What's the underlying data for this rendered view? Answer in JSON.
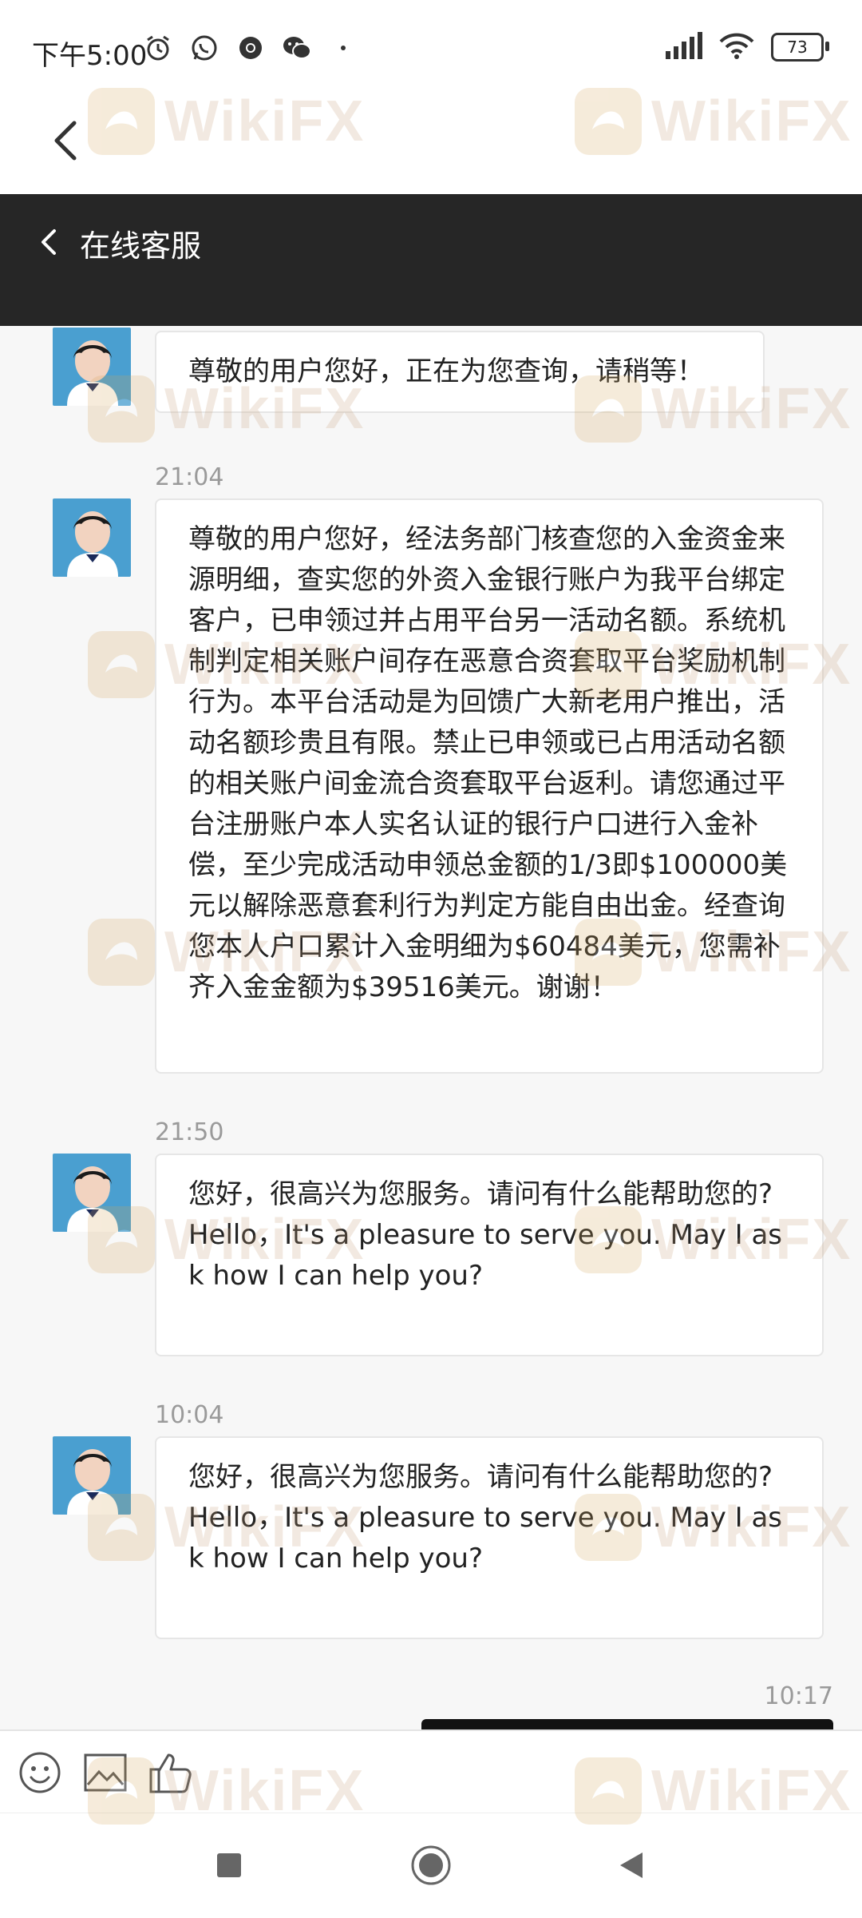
{
  "status_bar": {
    "time": "下午5:00",
    "battery": "73",
    "icons_left": [
      "alarm-icon",
      "whatsapp-icon",
      "chrome-icon",
      "wechat-icon",
      "dot-icon"
    ],
    "icons_right": [
      "signal-icon",
      "wifi-icon",
      "battery-icon"
    ]
  },
  "header": {
    "back_icon": "chevron-left-icon"
  },
  "service_bar": {
    "title": "在线客服",
    "back_icon": "chevron-left-icon"
  },
  "messages": [
    {
      "sender": "agent",
      "text": "尊敬的用户您好，正在为您查询，请稍等！"
    },
    {
      "timestamp": "21:04",
      "sender": "agent",
      "text": "尊敬的用户您好，经法务部门核查您的入金资金来源明细，查实您的外资入金银行账户为我平台绑定客户，已申领过并占用平台另一活动名额。系统机制判定相关账户间存在恶意合资套取平台奖励机制行为。本平台活动是为回馈广大新老用户推出，活动名额珍贵且有限。禁止已申领或已占用活动名额的相关账户间金流合资套取平台返利。请您通过平台注册账户本人实名认证的银行户口进行入金补偿，至少完成活动申领总金额的1/3即$100000美元以解除恶意套利行为判定方能自由出金。经查询您本人户口累计入金明细为$60484美元，您需补齐入金金额为$39516美元。谢谢！"
    },
    {
      "timestamp": "21:50",
      "sender": "agent",
      "text": "您好，很高兴为您服务。请问有什么能帮助您的?\nHello，It's a pleasure to serve you. May I ask how I can help you?"
    },
    {
      "timestamp": "10:04",
      "sender": "agent",
      "text": "您好，很高兴为您服务。请问有什么能帮助您的?\nHello，It's a pleasure to serve you. May I ask how I can help you?"
    },
    {
      "timestamp": "10:17",
      "sender": "user",
      "text": ""
    }
  ],
  "toolbar": {
    "icons": [
      "emoji-icon",
      "image-icon",
      "thumbs-up-icon"
    ]
  },
  "nav_bar": {
    "icons": [
      "recents-square-icon",
      "home-circle-icon",
      "back-triangle-icon"
    ]
  },
  "watermark": {
    "text": "WikiFX"
  },
  "colors": {
    "service_bar": "#262626",
    "background": "#f7f7f7",
    "bubble": "#ffffff",
    "timestamp": "#9a9a9a"
  }
}
